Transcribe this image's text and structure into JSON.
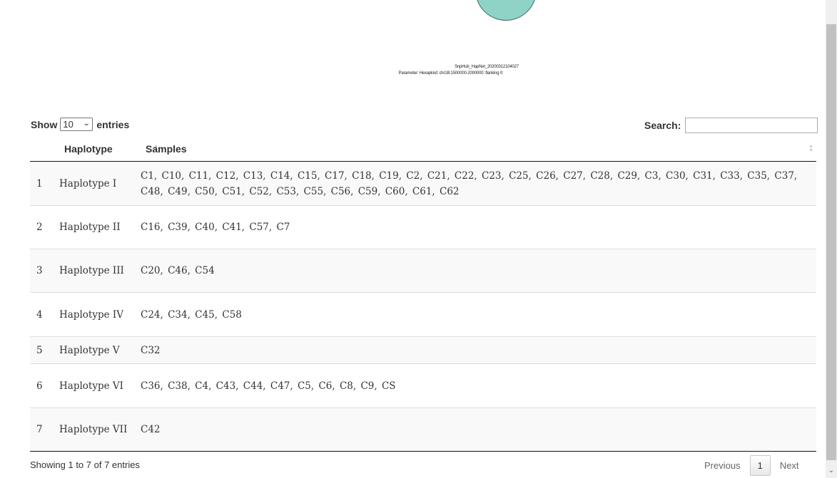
{
  "figure": {
    "caption_line1": "SnpHub_HapNet_20200312104027",
    "caption_line2": "Parameter: Hexaploid: chr1B:1500000-2000000: flanking 0:"
  },
  "length_control": {
    "show_label": "Show",
    "selected": "10",
    "entries_label": "entries"
  },
  "search": {
    "label": "Search:",
    "value": ""
  },
  "table": {
    "columns": {
      "haplotype": "Haplotype",
      "samples": "Samples"
    },
    "rows": [
      {
        "index": "1",
        "haplotype": "Haplotype I",
        "samples": "C1, C10, C11, C12, C13, C14, C15, C17, C18, C19, C2, C21, C22, C23, C25, C26, C27, C28, C29, C3, C30, C31, C33, C35, C37, C48, C49, C50, C51, C52, C53, C55, C56, C59, C60, C61, C62"
      },
      {
        "index": "2",
        "haplotype": "Haplotype II",
        "samples": "C16, C39, C40, C41, C57, C7"
      },
      {
        "index": "3",
        "haplotype": "Haplotype III",
        "samples": "C20, C46, C54"
      },
      {
        "index": "4",
        "haplotype": "Haplotype IV",
        "samples": "C24, C34, C45, C58"
      },
      {
        "index": "5",
        "haplotype": "Haplotype V",
        "samples": "C32"
      },
      {
        "index": "6",
        "haplotype": "Haplotype VI",
        "samples": "C36, C38, C4, C43, C44, C47, C5, C6, C8, C9, CS"
      },
      {
        "index": "7",
        "haplotype": "Haplotype VII",
        "samples": "C42"
      }
    ]
  },
  "info": "Showing 1 to 7 of 7 entries",
  "pagination": {
    "previous": "Previous",
    "current": "1",
    "next": "Next"
  }
}
